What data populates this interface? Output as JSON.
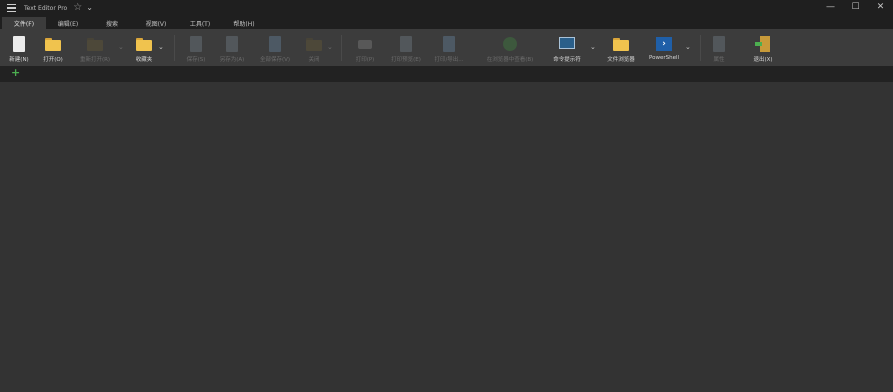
{
  "app": {
    "title": "Text Editor Pro"
  },
  "window_controls": {
    "minimize": "—",
    "maximize": "☐",
    "close": "✕"
  },
  "tabs": [
    {
      "label": "文件(F)"
    },
    {
      "label": "编辑(E)"
    },
    {
      "label": "搜索"
    },
    {
      "label": "视图(V)"
    },
    {
      "label": "工具(T)"
    },
    {
      "label": "帮助(H)"
    }
  ],
  "ribbon": {
    "new": "新建(N)",
    "open": "打开(O)",
    "reopen": "重新打开(R)",
    "favorites": "收藏夹",
    "save": "保存(S)",
    "save_as": "另存为(A)",
    "save_all": "全部保存(V)",
    "close": "关闭",
    "print": "打印(P)",
    "print_preview": "打印预览(E)",
    "print_settings": "打印/导出...",
    "open_in_browser": "在浏览器中查看(B)",
    "command_prompt": "命令提示符",
    "file_explorer": "文件浏览器",
    "powershell": "PowerShell",
    "properties": "属性",
    "exit": "退出(X)"
  },
  "docbar": {
    "add_tab": "+"
  }
}
